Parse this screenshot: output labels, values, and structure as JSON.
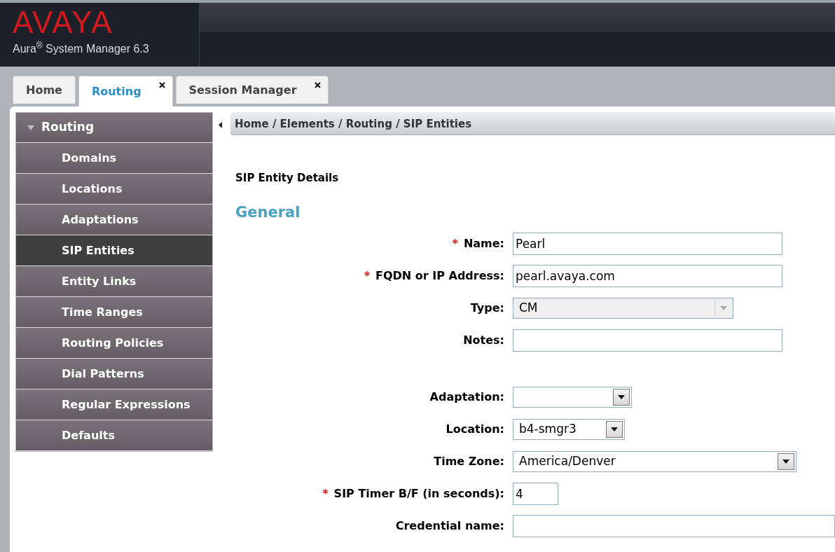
{
  "header": {
    "logo": "AVAYA",
    "product": "Aura$^{®}$ System Manager 6.3"
  },
  "tabs": [
    {
      "label": "Home",
      "selected": false,
      "closable": false
    },
    {
      "label": "Routing",
      "selected": true,
      "closable": true
    },
    {
      "label": "Session Manager",
      "selected": false,
      "closable": true
    }
  ],
  "sidebar": {
    "title": "Routing",
    "expanded": true,
    "items": [
      {
        "label": "Domains",
        "selected": false
      },
      {
        "label": "Locations",
        "selected": false
      },
      {
        "label": "Adaptations",
        "selected": false
      },
      {
        "label": "SIP Entities",
        "selected": true
      },
      {
        "label": "Entity Links",
        "selected": false
      },
      {
        "label": "Time Ranges",
        "selected": false
      },
      {
        "label": "Routing Policies",
        "selected": false
      },
      {
        "label": "Dial Patterns",
        "selected": false
      },
      {
        "label": "Regular Expressions",
        "selected": false
      },
      {
        "label": "Defaults",
        "selected": false
      }
    ]
  },
  "breadcrumb": "Home / Elements / Routing / SIP Entities",
  "form": {
    "required_mark": "*",
    "title": "SIP Entity Details",
    "section": "General",
    "fields": [
      {
        "kind": "text",
        "label": "Name:",
        "required": true,
        "value": "Pearl"
      },
      {
        "kind": "text",
        "label": "FQDN or IP Address:",
        "required": true,
        "value": "pearl.avaya.com"
      },
      {
        "kind": "select",
        "label": "Type:",
        "required": false,
        "disabled": true,
        "value": "CM"
      },
      {
        "kind": "text",
        "label": "Notes:",
        "required": false
      },
      {
        "kind": "spacer"
      },
      {
        "kind": "select",
        "label": "Adaptation:",
        "required": false,
        "disabled": false
      },
      {
        "kind": "select",
        "label": "Location:",
        "required": false,
        "disabled": false,
        "value": "b4-smgr3"
      },
      {
        "kind": "select",
        "label": "Time Zone:",
        "required": false,
        "disabled": false,
        "value": "America/Denver"
      },
      {
        "kind": "text",
        "label": "SIP Timer B/F (in seconds):",
        "required": true,
        "value": "4"
      },
      {
        "kind": "text",
        "label": "Credential name:",
        "required": false
      }
    ]
  }
}
